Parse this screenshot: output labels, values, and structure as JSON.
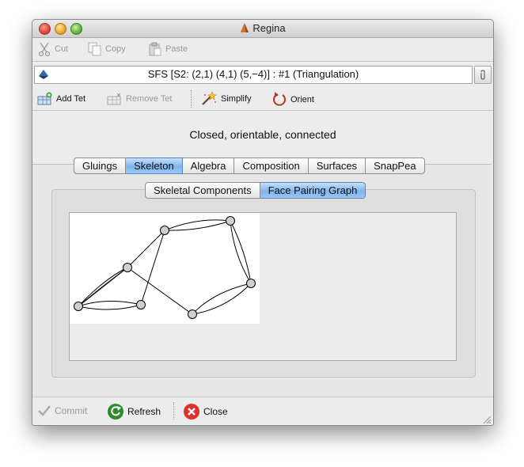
{
  "window": {
    "title": "Regina"
  },
  "edit_toolbar": {
    "cut": "Cut",
    "copy": "Copy",
    "paste": "Paste"
  },
  "packet": {
    "label": "SFS [S2: (2,1) (4,1) (5,−4)] : #1 (Triangulation)"
  },
  "triangulation_toolbar": {
    "add_tet": "Add Tet",
    "remove_tet": "Remove Tet",
    "simplify": "Simplify",
    "orient": "Orient"
  },
  "status": "Closed, orientable, connected",
  "tabs": [
    "Gluings",
    "Skeleton",
    "Algebra",
    "Composition",
    "Surfaces",
    "SnapPea"
  ],
  "selected_tab": "Skeleton",
  "subtabs": [
    "Skeletal Components",
    "Face Pairing Graph"
  ],
  "selected_subtab": "Face Pairing Graph",
  "bottom_toolbar": {
    "commit": "Commit",
    "refresh": "Refresh",
    "close": "Close"
  },
  "colors": {
    "selected_tab": "#7fb4ee",
    "window_bg": "#ececec",
    "close_red": "#d8322a",
    "refresh_green": "#2e8a2e"
  }
}
